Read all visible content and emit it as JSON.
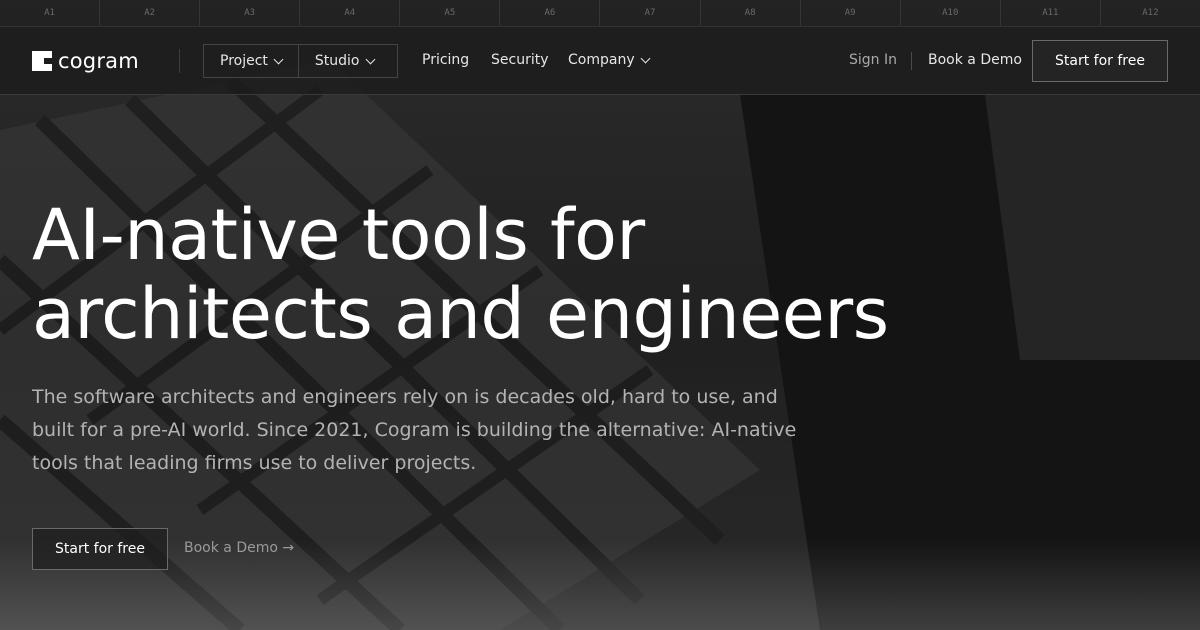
{
  "ruler": [
    "A1",
    "A2",
    "A3",
    "A4",
    "A5",
    "A6",
    "A7",
    "A8",
    "A9",
    "A10",
    "A11",
    "A12"
  ],
  "brand": {
    "name": "cogram"
  },
  "nav": {
    "group": [
      {
        "label": "Project"
      },
      {
        "label": "Studio"
      }
    ],
    "links": {
      "pricing": "Pricing",
      "security": "Security",
      "company": "Company"
    },
    "sign_in": "Sign In",
    "book_demo": "Book a Demo",
    "cta": "Start for free"
  },
  "hero": {
    "headline_line1": "AI-native tools for",
    "headline_line2": "architects and engineers",
    "lede": "The software architects and engineers rely on is decades old, hard to use, and built for a pre-AI world. Since 2021, Cogram is building the alternative: AI-native tools that leading firms use to deliver projects.",
    "cta_primary": "Start for free",
    "cta_secondary": "Book a Demo →"
  },
  "colors": {
    "background": "#1c1c1c",
    "text": "#ffffff",
    "muted": "#b3b3b3"
  }
}
